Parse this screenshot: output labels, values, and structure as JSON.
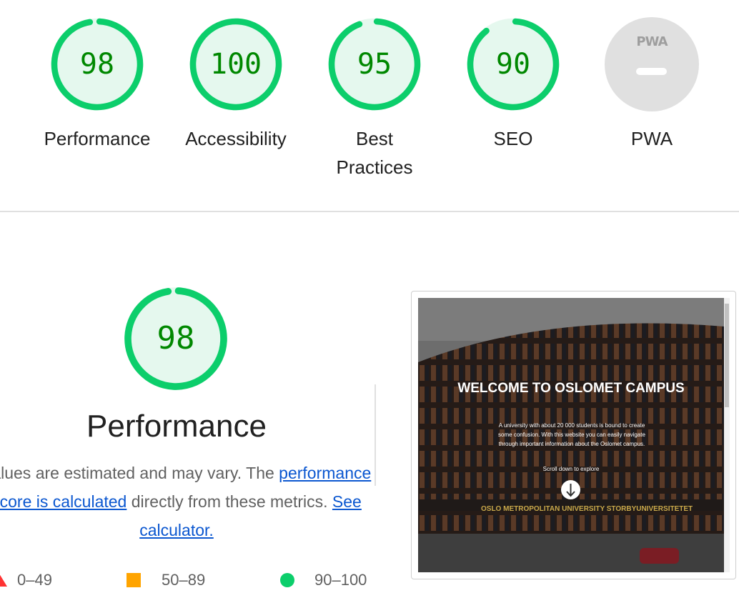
{
  "categories": [
    {
      "label": "Performance",
      "score": "98",
      "value": 98
    },
    {
      "label": "Accessibility",
      "score": "100",
      "value": 100
    },
    {
      "label": "Best Practices",
      "score": "95",
      "value": 95
    },
    {
      "label": "SEO",
      "score": "90",
      "value": 90
    },
    {
      "label": "PWA",
      "badge": "PWA"
    }
  ],
  "performance": {
    "score": "98",
    "value": 98,
    "title": "Performance",
    "desc_prefix": "Values are estimated and may vary. The ",
    "desc_link": "performance score is calculated",
    "desc_middle": " directly from these metrics. ",
    "calc_link": "See calculator."
  },
  "legend": [
    {
      "range": "0–49",
      "shape": "triangle",
      "color": "#ff3333"
    },
    {
      "range": "50–89",
      "shape": "square",
      "color": "#ffa400"
    },
    {
      "range": "90–100",
      "shape": "circle",
      "color": "#0cce6b"
    }
  ],
  "screenshot": {
    "title": "WELCOME TO OSLOMET CAMPUS",
    "text": "A university with about 20 000 students is bound to create some confusion. With this website you can easily navigate through important information about the Oslomet campus.",
    "scroll_text": "Scroll down to explore",
    "sign": "OSLO METROPOLITAN UNIVERSITY   STORBYUNIVERSITETET"
  },
  "colors": {
    "pass": "#0cce6b",
    "pass_fill": "#e5f8ee",
    "pass_text": "#008800",
    "pwa_gray": "#e0e0e0"
  }
}
